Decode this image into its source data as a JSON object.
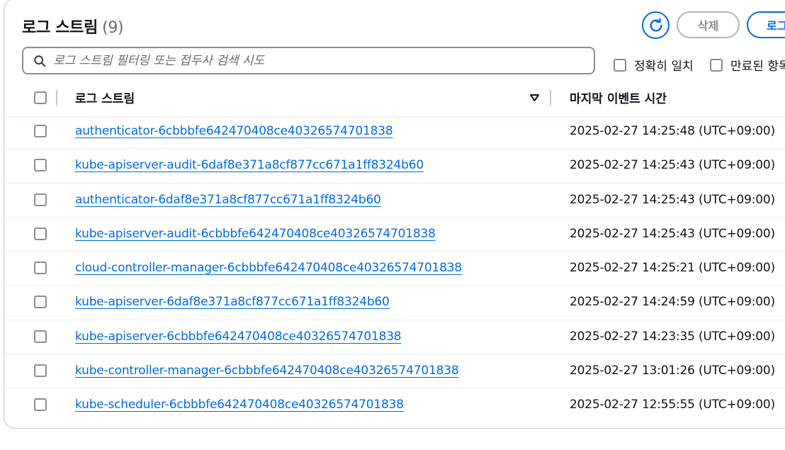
{
  "header": {
    "title": "로그 스트림",
    "count": "(9)",
    "delete_label": "삭제",
    "create_label": "로그"
  },
  "search": {
    "placeholder": "로그 스트림 필터링 또는 접두사 검색 시도",
    "value": ""
  },
  "options": {
    "exact_match": "정확히 일치",
    "expired": "만료된 항목"
  },
  "table": {
    "columns": [
      "로그 스트림",
      "마지막 이벤트 시간"
    ],
    "rows": [
      {
        "name": "authenticator-6cbbbfe642470408ce40326574701838",
        "time": "2025-02-27 14:25:48 (UTC+09:00)"
      },
      {
        "name": "kube-apiserver-audit-6daf8e371a8cf877cc671a1ff8324b60",
        "time": "2025-02-27 14:25:43 (UTC+09:00)"
      },
      {
        "name": "authenticator-6daf8e371a8cf877cc671a1ff8324b60",
        "time": "2025-02-27 14:25:43 (UTC+09:00)"
      },
      {
        "name": "kube-apiserver-audit-6cbbbfe642470408ce40326574701838",
        "time": "2025-02-27 14:25:43 (UTC+09:00)"
      },
      {
        "name": "cloud-controller-manager-6cbbbfe642470408ce40326574701838",
        "time": "2025-02-27 14:25:21 (UTC+09:00)"
      },
      {
        "name": "kube-apiserver-6daf8e371a8cf877cc671a1ff8324b60",
        "time": "2025-02-27 14:24:59 (UTC+09:00)"
      },
      {
        "name": "kube-apiserver-6cbbbfe642470408ce40326574701838",
        "time": "2025-02-27 14:23:35 (UTC+09:00)"
      },
      {
        "name": "kube-controller-manager-6cbbbfe642470408ce40326574701838",
        "time": "2025-02-27 13:01:26 (UTC+09:00)"
      },
      {
        "name": "kube-scheduler-6cbbbfe642470408ce40326574701838",
        "time": "2025-02-27 12:55:55 (UTC+09:00)"
      }
    ]
  },
  "colors": {
    "link": "#006ce0",
    "border": "#c6c6cd",
    "text": "#0f141a"
  }
}
